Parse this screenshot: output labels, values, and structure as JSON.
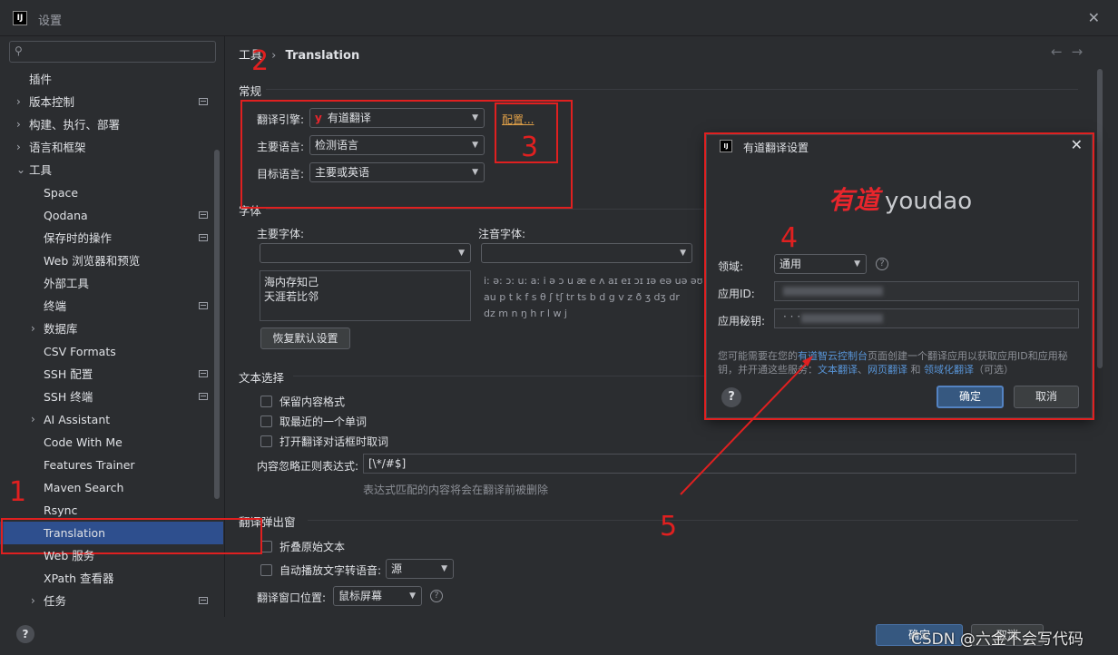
{
  "window": {
    "title": "设置"
  },
  "search": {
    "placeholder": ""
  },
  "sidebar": {
    "items": [
      {
        "label": "插件",
        "level": 0,
        "arrow": "",
        "icon": false
      },
      {
        "label": "版本控制",
        "level": 0,
        "arrow": "›",
        "icon": true
      },
      {
        "label": "构建、执行、部署",
        "level": 0,
        "arrow": "›",
        "icon": false
      },
      {
        "label": "语言和框架",
        "level": 0,
        "arrow": "›",
        "icon": false
      },
      {
        "label": "工具",
        "level": 0,
        "arrow": "⌄",
        "icon": false
      },
      {
        "label": "Space",
        "level": 1,
        "arrow": "",
        "icon": false
      },
      {
        "label": "Qodana",
        "level": 1,
        "arrow": "",
        "icon": true
      },
      {
        "label": "保存时的操作",
        "level": 1,
        "arrow": "",
        "icon": true
      },
      {
        "label": "Web 浏览器和预览",
        "level": 1,
        "arrow": "",
        "icon": false
      },
      {
        "label": "外部工具",
        "level": 1,
        "arrow": "",
        "icon": false
      },
      {
        "label": "终端",
        "level": 1,
        "arrow": "",
        "icon": true
      },
      {
        "label": "数据库",
        "level": 1,
        "arrow": "›",
        "icon": false
      },
      {
        "label": "CSV Formats",
        "level": 1,
        "arrow": "",
        "icon": false
      },
      {
        "label": "SSH 配置",
        "level": 1,
        "arrow": "",
        "icon": true
      },
      {
        "label": "SSH 终端",
        "level": 1,
        "arrow": "",
        "icon": true
      },
      {
        "label": "AI Assistant",
        "level": 1,
        "arrow": "›",
        "icon": false
      },
      {
        "label": "Code With Me",
        "level": 1,
        "arrow": "",
        "icon": false
      },
      {
        "label": "Features Trainer",
        "level": 1,
        "arrow": "",
        "icon": false
      },
      {
        "label": "Maven Search",
        "level": 1,
        "arrow": "",
        "icon": false
      },
      {
        "label": "Rsync",
        "level": 1,
        "arrow": "",
        "icon": false
      },
      {
        "label": "Translation",
        "level": 1,
        "arrow": "",
        "icon": false,
        "selected": true
      },
      {
        "label": "Web 服务",
        "level": 1,
        "arrow": "",
        "icon": false
      },
      {
        "label": "XPath 查看器",
        "level": 1,
        "arrow": "",
        "icon": false
      },
      {
        "label": "任务",
        "level": 1,
        "arrow": "›",
        "icon": true
      }
    ]
  },
  "breadcrumb": {
    "parent": "工具",
    "sep": "›",
    "current": "Translation"
  },
  "nav": {
    "back": "←",
    "forward": "→"
  },
  "general": {
    "header": "常规",
    "engine_label": "翻译引擎:",
    "engine_value": "有道翻译",
    "engine_icon": "y",
    "configure_link": "配置...",
    "primary_lang_label": "主要语言:",
    "primary_lang_value": "检测语言",
    "target_lang_label": "目标语言:",
    "target_lang_value": "主要或英语"
  },
  "font": {
    "header": "字体",
    "primary_label": "主要字体:",
    "phonetic_label": "注音字体:",
    "primary_sample": "海内存知己\n天涯若比邻",
    "phonetic_sample": "i: ə: ɔ: u: a: i ə ɔ u æ e ʌ aɪ eɪ ɔɪ ɪə eə uə əʊ\nau p t k f s θ ʃ tʃ tr ts b d g v z ð ʒ dʒ dr\ndz m n ŋ h r l w j",
    "reset_button": "恢复默认设置"
  },
  "text_selection": {
    "header": "文本选择",
    "opt1": "保留内容格式",
    "opt2": "取最近的一个单词",
    "opt3": "打开翻译对话框时取词",
    "regex_label": "内容忽略正则表达式:",
    "regex_value": "[\\*/#$]",
    "regex_hint": "表达式匹配的内容将会在翻译前被删除"
  },
  "popup": {
    "header": "翻译弹出窗",
    "opt1": "折叠原始文本",
    "opt2": "自动播放文字转语音:",
    "tts_value": "源",
    "position_label": "翻译窗口位置:",
    "position_value": "鼠标屏幕"
  },
  "footer": {
    "ok": "确定",
    "cancel": "取消",
    "help": "?"
  },
  "watermark": "CSDN @六金不会写代码",
  "dialog": {
    "title": "有道翻译设置",
    "logo_cn": "有道",
    "logo_en": "youdao",
    "domain_label": "领域:",
    "domain_value": "通用",
    "app_id_label": "应用ID:",
    "app_secret_label": "应用秘钥:",
    "app_secret_dots": "· · ·",
    "note_1": "您可能需要在您的",
    "note_link1": "有道智云控制台",
    "note_2": "页面创建一个翻译应用以获取应用ID和应用秘钥，并开通这些服务：",
    "note_link2": "文本翻译",
    "note_3": "、",
    "note_link3": "网页翻译",
    "note_4": " 和 ",
    "note_link4": "领域化翻译",
    "note_5": "（可选）",
    "ok": "确定",
    "cancel": "取消",
    "help": "?",
    "close": "✕"
  },
  "annotations": {
    "n1": "1",
    "n2": "2",
    "n3": "3",
    "n4": "4",
    "n5": "5",
    "color": "#e02020"
  },
  "icons": {
    "app": "intellij-logo-icon",
    "close": "close-icon",
    "search": "search-icon",
    "caret": "chevron-down-icon"
  }
}
